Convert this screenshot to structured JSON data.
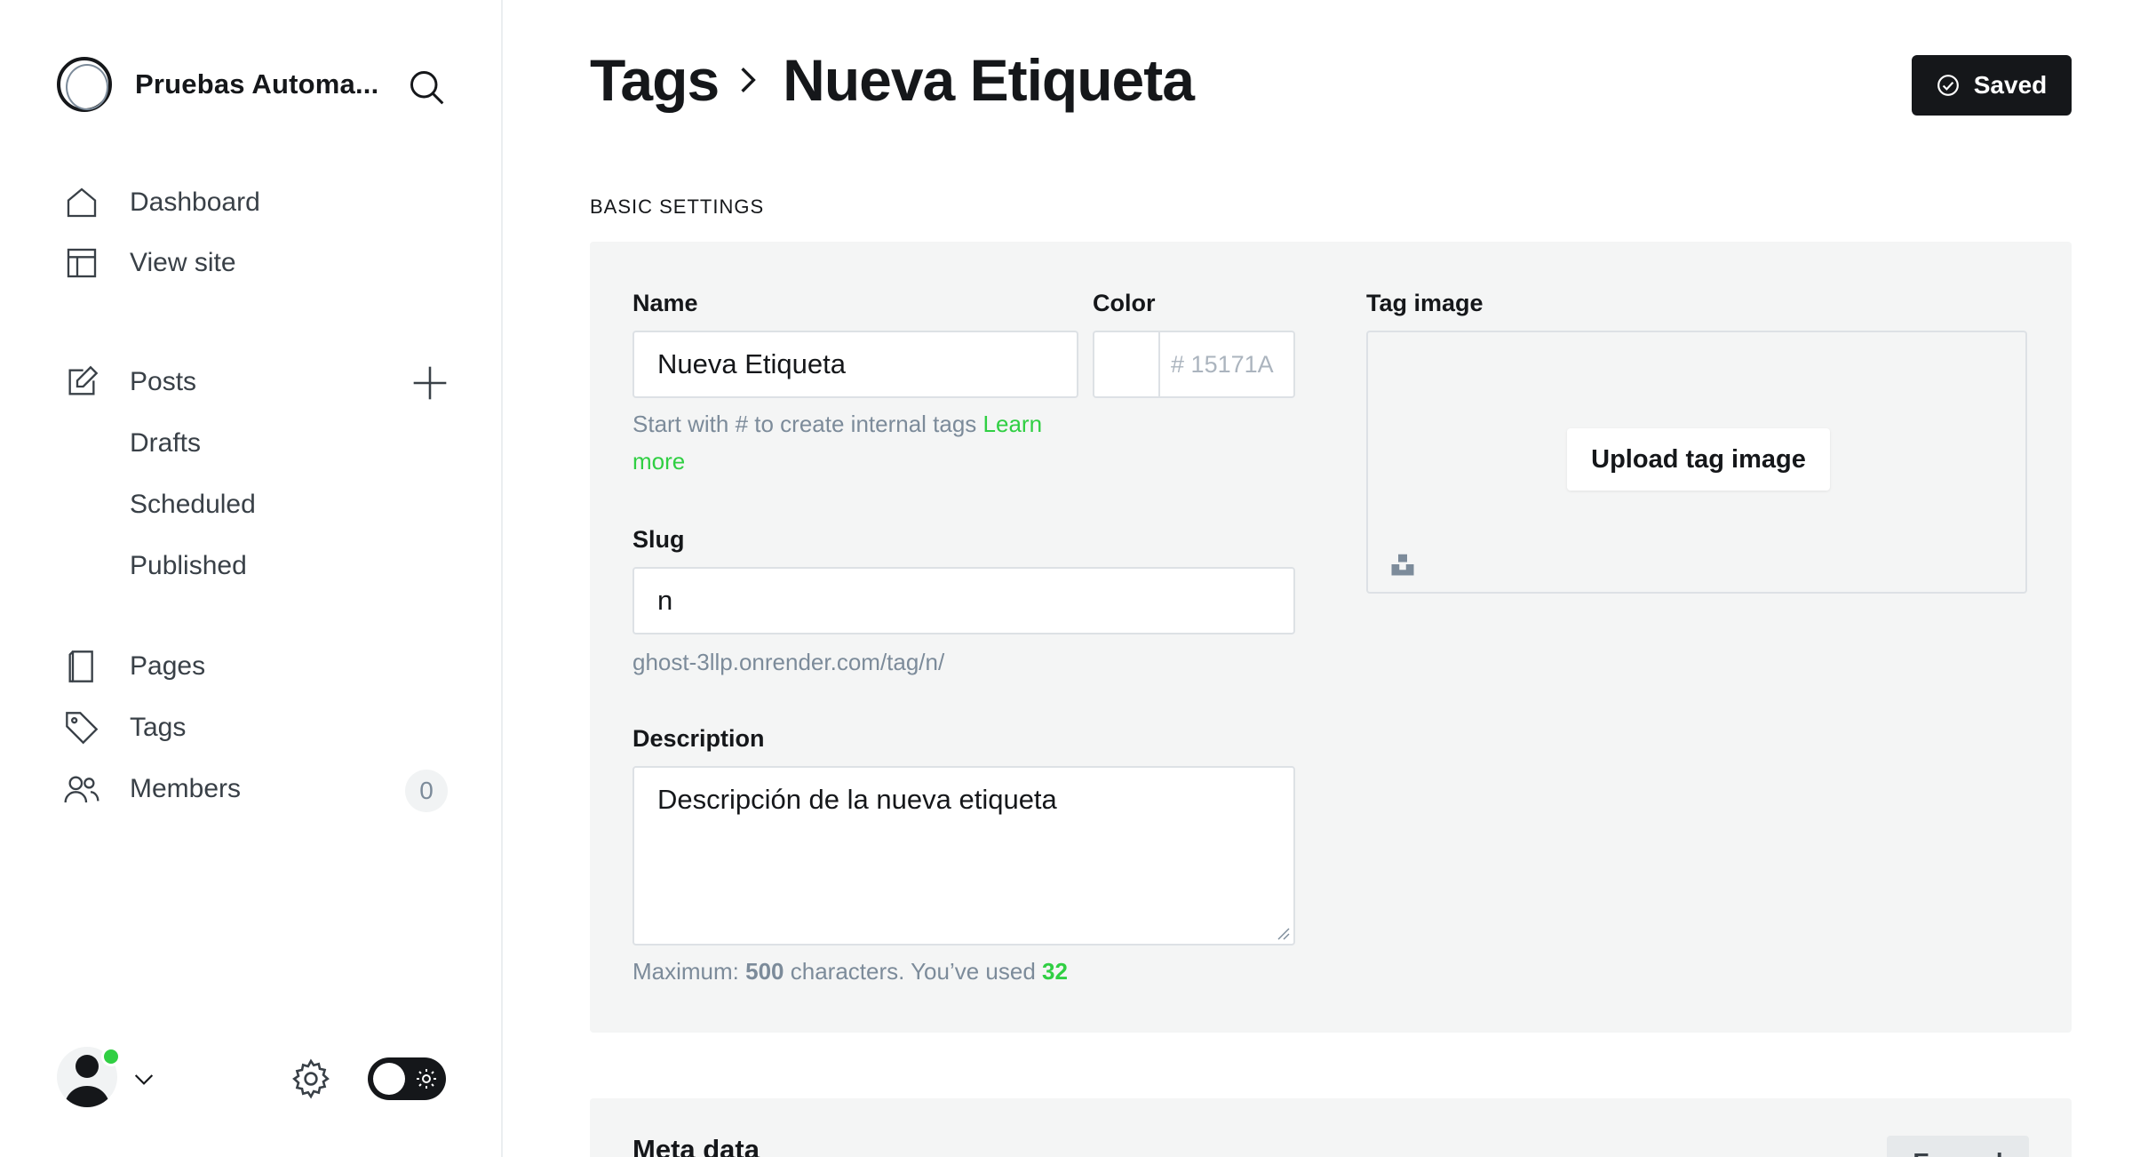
{
  "sidebar": {
    "site_name": "Pruebas Automa...",
    "nav": {
      "dashboard": "Dashboard",
      "view_site": "View site",
      "posts": "Posts",
      "drafts": "Drafts",
      "scheduled": "Scheduled",
      "published": "Published",
      "pages": "Pages",
      "tags": "Tags",
      "members": "Members",
      "members_count": "0"
    }
  },
  "header": {
    "breadcrumb_parent": "Tags",
    "title": "Nueva Etiqueta",
    "save_status": "Saved"
  },
  "basic_settings": {
    "section_label": "BASIC SETTINGS",
    "name_label": "Name",
    "name_value": "Nueva Etiqueta",
    "name_hint": "Start with # to create internal tags ",
    "name_hint_link": "Learn more",
    "color_label": "Color",
    "color_hash": "#",
    "color_placeholder": "15171A",
    "slug_label": "Slug",
    "slug_value": "n",
    "slug_url": "ghost-3llp.onrender.com/tag/n/",
    "description_label": "Description",
    "description_value": "Descripción de la nueva etiqueta",
    "desc_hint_prefix": "Maximum: ",
    "desc_max": "500",
    "desc_hint_middle": " characters. You’ve used ",
    "desc_used": "32",
    "image_label": "Tag image",
    "upload_label": "Upload tag image"
  },
  "meta": {
    "title": "Meta data",
    "expand_label": "Expand"
  },
  "colors": {
    "accent": "#30cf43",
    "dark": "#15171a",
    "panel_bg": "#f4f5f5"
  }
}
